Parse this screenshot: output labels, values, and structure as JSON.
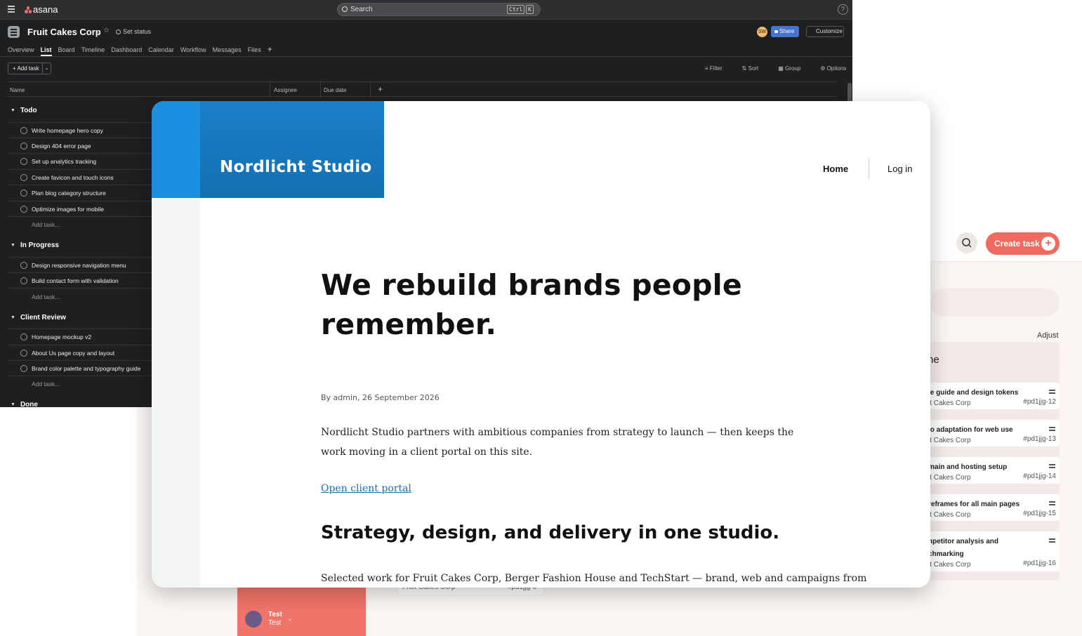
{
  "asana": {
    "logo": "asana",
    "search_placeholder": "Search",
    "kbd1": "Ctrl",
    "kbd2": "K",
    "help": "?",
    "project": "Fruit Cakes Corp",
    "set_status": "Set status",
    "avatar_initials": "SW",
    "share": "Share",
    "customize": "Customize",
    "tabs": [
      "Overview",
      "List",
      "Board",
      "Timeline",
      "Dashboard",
      "Calendar",
      "Workflow",
      "Messages",
      "Files"
    ],
    "add_task_button": "Add task",
    "toolbar": {
      "filter": "Filter",
      "sort": "Sort",
      "group": "Group",
      "options": "Options"
    },
    "columns": {
      "name": "Name",
      "assignee": "Assignee",
      "due": "Due date"
    },
    "add_task_placeholder": "Add task...",
    "sections": [
      {
        "name": "Todo",
        "tasks": [
          "Write homepage hero copy",
          "Design 404 error page",
          "Set up analytics tracking",
          "Create favicon and touch icons",
          "Plan blog category structure",
          "Optimize images for mobile"
        ]
      },
      {
        "name": "In Progress",
        "tasks": [
          "Design responsive navigation menu",
          "Build contact form with validation"
        ]
      },
      {
        "name": "Client Review",
        "tasks": [
          "Homepage mockup v2",
          "About Us page copy and layout",
          "Brand color palette and typography guide"
        ]
      },
      {
        "name": "Done",
        "tasks": []
      }
    ]
  },
  "site": {
    "brand": "Nordlicht Studio",
    "nav": {
      "home": "Home",
      "login": "Log in"
    },
    "headline": "We rebuild brands people remember.",
    "meta": "By admin, 26 September 2026",
    "intro": "Nordlicht Studio partners with ambitious companies from strategy to launch — then keeps the work moving in a client portal on this site.",
    "portal_link": "Open client portal",
    "subheadline": "Strategy, design, and delivery in one studio.",
    "body": "Selected work for Fruit Cakes Corp, Berger Fashion House and TechStart — brand, web and campaigns from"
  },
  "taskapp": {
    "create_task": "Create task",
    "adjust": "Adjust",
    "column_title_fragment": "ne",
    "cards": [
      {
        "title": "le guide and design tokens",
        "project": "it Cakes Corp",
        "id": "#pd1jjg-12"
      },
      {
        "title": "jo adaptation for web use",
        "project": "it Cakes Corp",
        "id": "#pd1jjg-13"
      },
      {
        "title": "main and hosting setup",
        "project": "it Cakes Corp",
        "id": "#pd1jjg-14"
      },
      {
        "title": "reframes for all main pages",
        "project": "it Cakes Corp",
        "id": "#pd1jjg-15"
      },
      {
        "title": "npetitor analysis and chmarking",
        "project": "it Cakes Corp",
        "id": "#pd1jjg-16"
      }
    ],
    "hidden_card": {
      "project": "Fruit Cakes Corp",
      "id": "#pd1jjg-6"
    },
    "user": {
      "name": "Test",
      "sub": "Test"
    }
  }
}
